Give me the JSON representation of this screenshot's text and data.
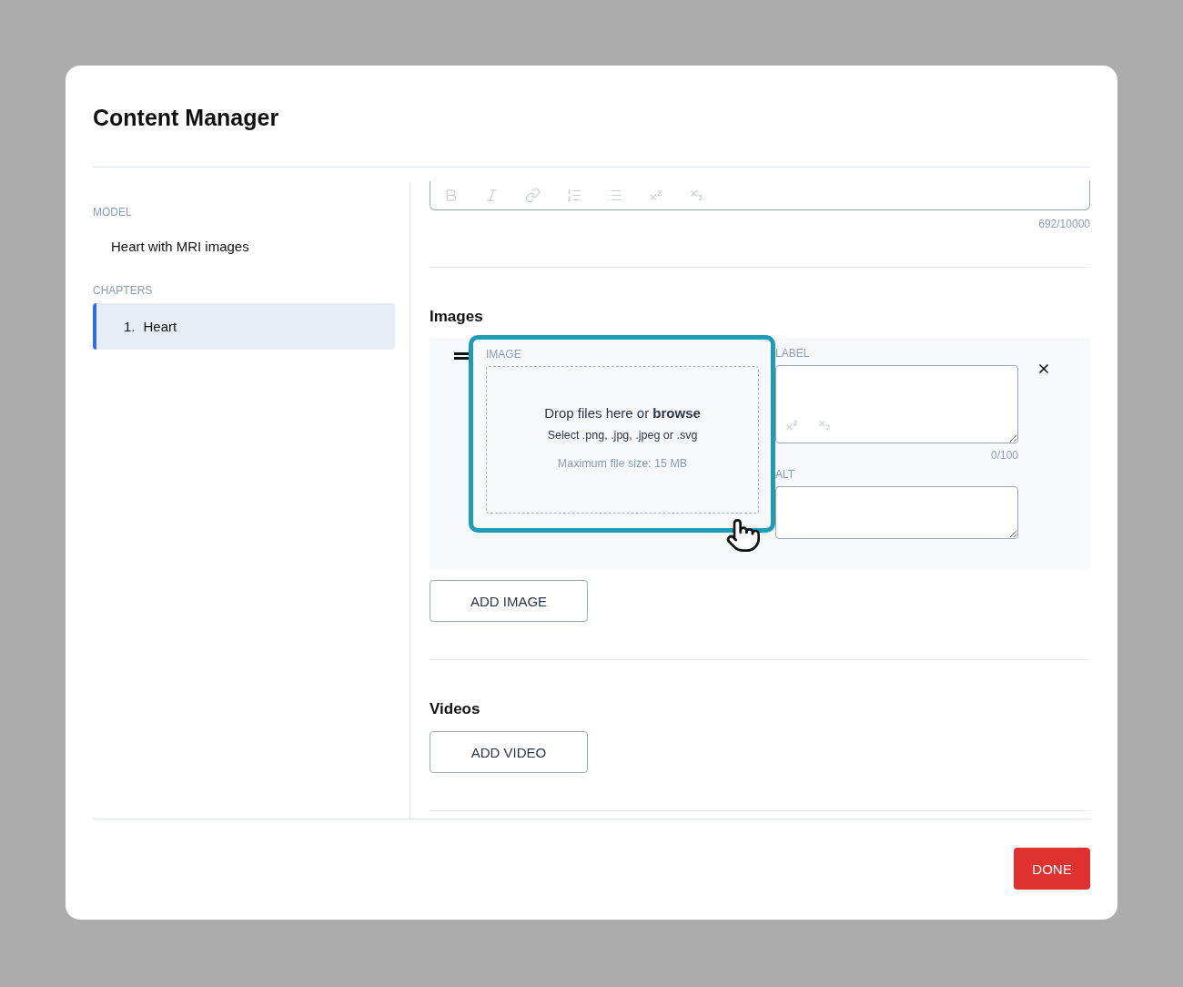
{
  "window": {
    "title": "Content Manager"
  },
  "sidebar": {
    "model": {
      "heading": "MODEL",
      "value": "Heart with MRI images"
    },
    "chapters": {
      "heading": "CHAPTERS",
      "items": [
        {
          "number": "1.",
          "label": "Heart",
          "selected": true
        }
      ]
    }
  },
  "editor": {
    "counter": "692/10000"
  },
  "images": {
    "heading": "Images",
    "items": [
      {
        "highlighted": true,
        "image_label": "IMAGE",
        "dropzone": {
          "prompt": "Drop files here or **browse**",
          "formats": "Select .png, .jpg, .jpeg or .svg",
          "max_size": "Maximum file size: 15 MB"
        },
        "label_field": {
          "label": "LABEL",
          "counter": "0/100"
        },
        "alt_field": {
          "label": "ALT"
        }
      }
    ],
    "add_button": "ADD IMAGE"
  },
  "videos": {
    "heading": "Videos",
    "add_button": "ADD VIDEO"
  },
  "footer": {
    "done_button": "DONE"
  }
}
